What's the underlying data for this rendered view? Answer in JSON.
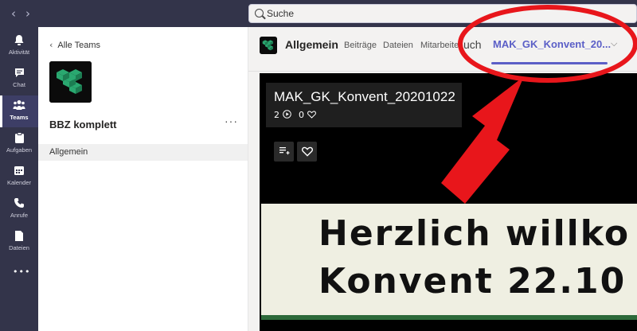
{
  "search": {
    "placeholder": "Suche"
  },
  "nav": {
    "back": "‹",
    "forward": "›"
  },
  "rail": [
    {
      "icon": "bell-icon",
      "glyph": "🔔",
      "label": "Aktivität"
    },
    {
      "icon": "chat-icon",
      "glyph": "💬",
      "label": "Chat"
    },
    {
      "icon": "teams-icon",
      "glyph": "👥",
      "label": "Teams"
    },
    {
      "icon": "tasks-icon",
      "glyph": "📋",
      "label": "Aufgaben"
    },
    {
      "icon": "calendar-icon",
      "glyph": "📅",
      "label": "Kalender"
    },
    {
      "icon": "phone-icon",
      "glyph": "📞",
      "label": "Anrufe"
    },
    {
      "icon": "files-icon",
      "glyph": "📄",
      "label": "Dateien"
    },
    {
      "icon": "more-apps-icon",
      "glyph": "•••",
      "label": ""
    }
  ],
  "panel": {
    "back_label": "Alle Teams",
    "team_name": "BBZ komplett",
    "more": "···",
    "channel": "Allgemein"
  },
  "header": {
    "channel_title": "Allgemein",
    "tabs": [
      "Beiträge",
      "Dateien",
      "Mitarbeite"
    ],
    "overlap_text": "uch",
    "active_tab": "MAK_GK_Konvent_20...",
    "chevron": "⌵"
  },
  "video": {
    "title": "MAK_GK_Konvent_20201022",
    "views": "2",
    "likes": "0",
    "slide_line1": "Herzlich willko",
    "slide_line2": "Konvent 22.10"
  },
  "colors": {
    "rail_bg": "#33344a",
    "accent": "#5b5fc7",
    "annotation": "#e8161b"
  }
}
